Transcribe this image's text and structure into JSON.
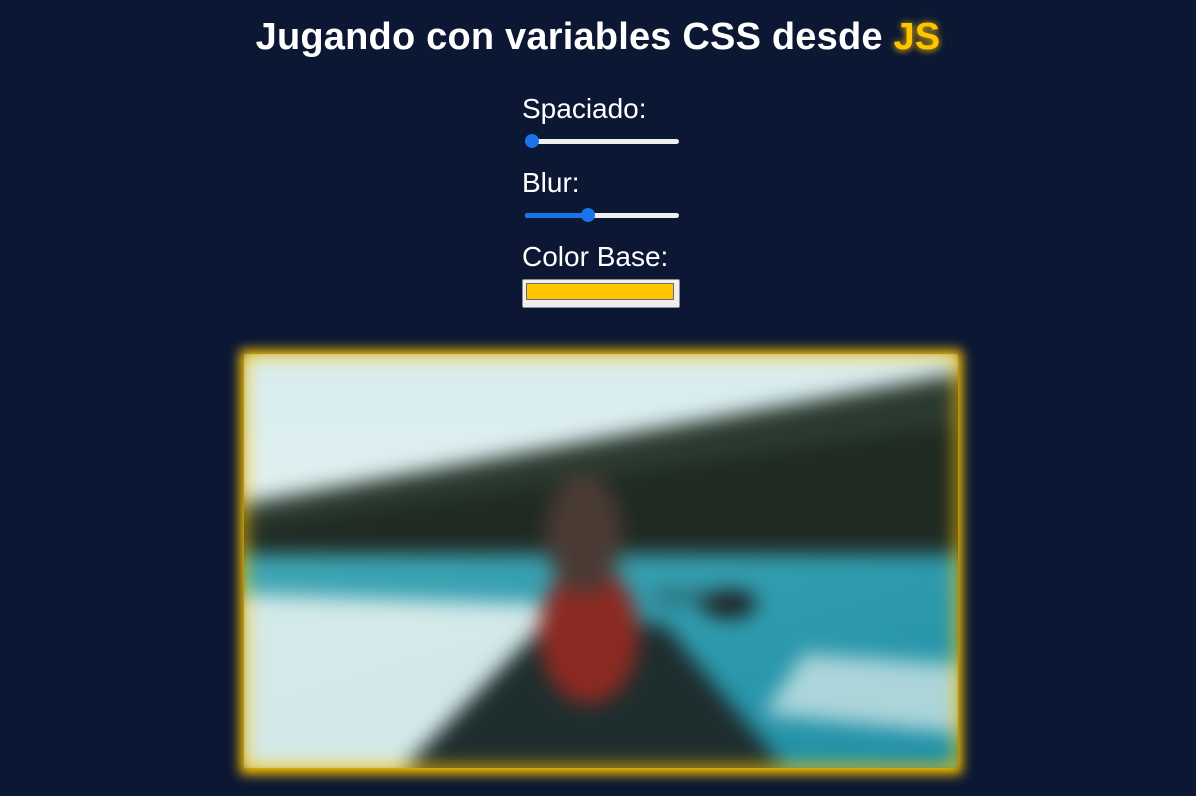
{
  "page": {
    "title_main": "Jugando con variables CSS desde ",
    "title_highlight": "JS"
  },
  "controls": {
    "spacing_label": "Spaciado:",
    "spacing_value": 0,
    "blur_label": "Blur:",
    "blur_value": 0.4,
    "color_label": "Color Base:",
    "color_value": "#ffc600"
  },
  "colors": {
    "background": "#0b1733",
    "accent": "#ffc600",
    "slider": "#1a73e8"
  },
  "image": {
    "subject": "person-in-canoe-on-lake-photo"
  }
}
